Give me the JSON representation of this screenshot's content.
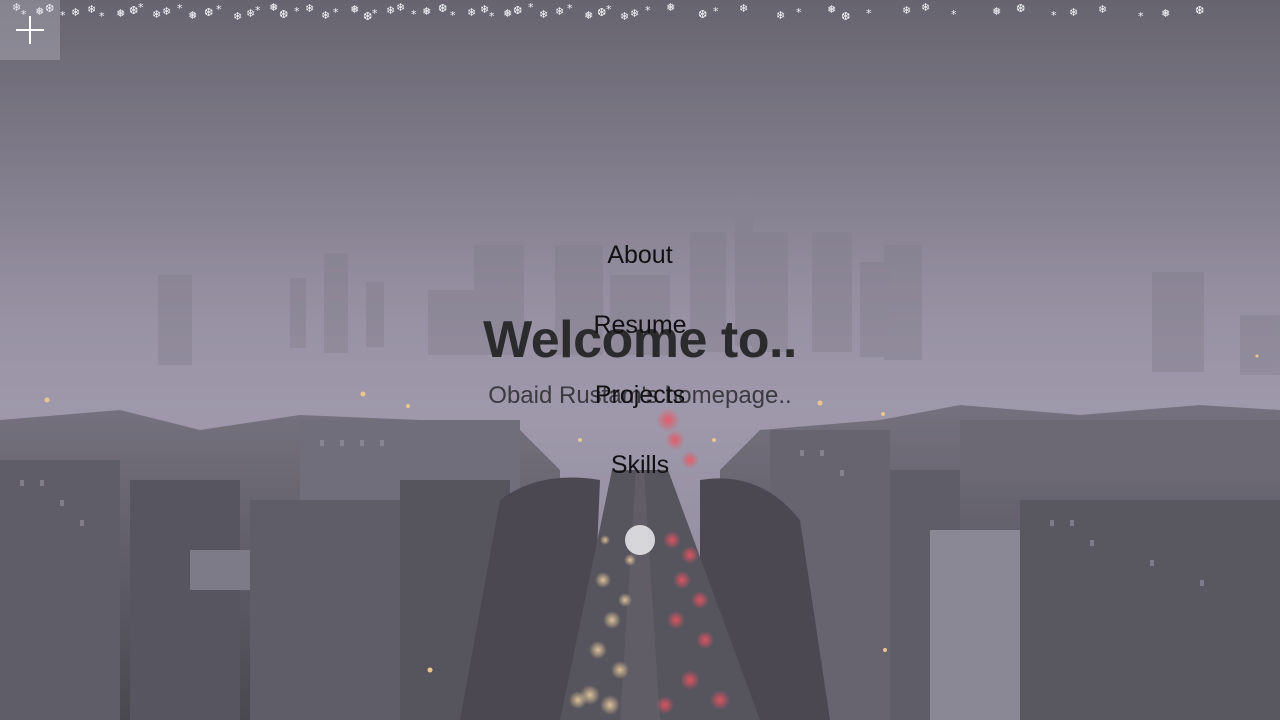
{
  "hero": {
    "title": "Welcome to..",
    "subtitle": "Obaid Rustam's homepage.."
  },
  "nav": {
    "items": [
      {
        "label": "About"
      },
      {
        "label": "Resume"
      },
      {
        "label": "Projects"
      },
      {
        "label": "Skills"
      }
    ]
  },
  "icons": {
    "menu_toggle": "plus-icon",
    "decoration": "snowflake-icon",
    "cursor": "cursor-dot"
  },
  "colors": {
    "title_text": "#2b2b2e",
    "subtitle_text": "#3a3a40",
    "nav_text": "#111114",
    "toggle_bg": "#cdcdd7",
    "snow": "#f4f4f8"
  }
}
